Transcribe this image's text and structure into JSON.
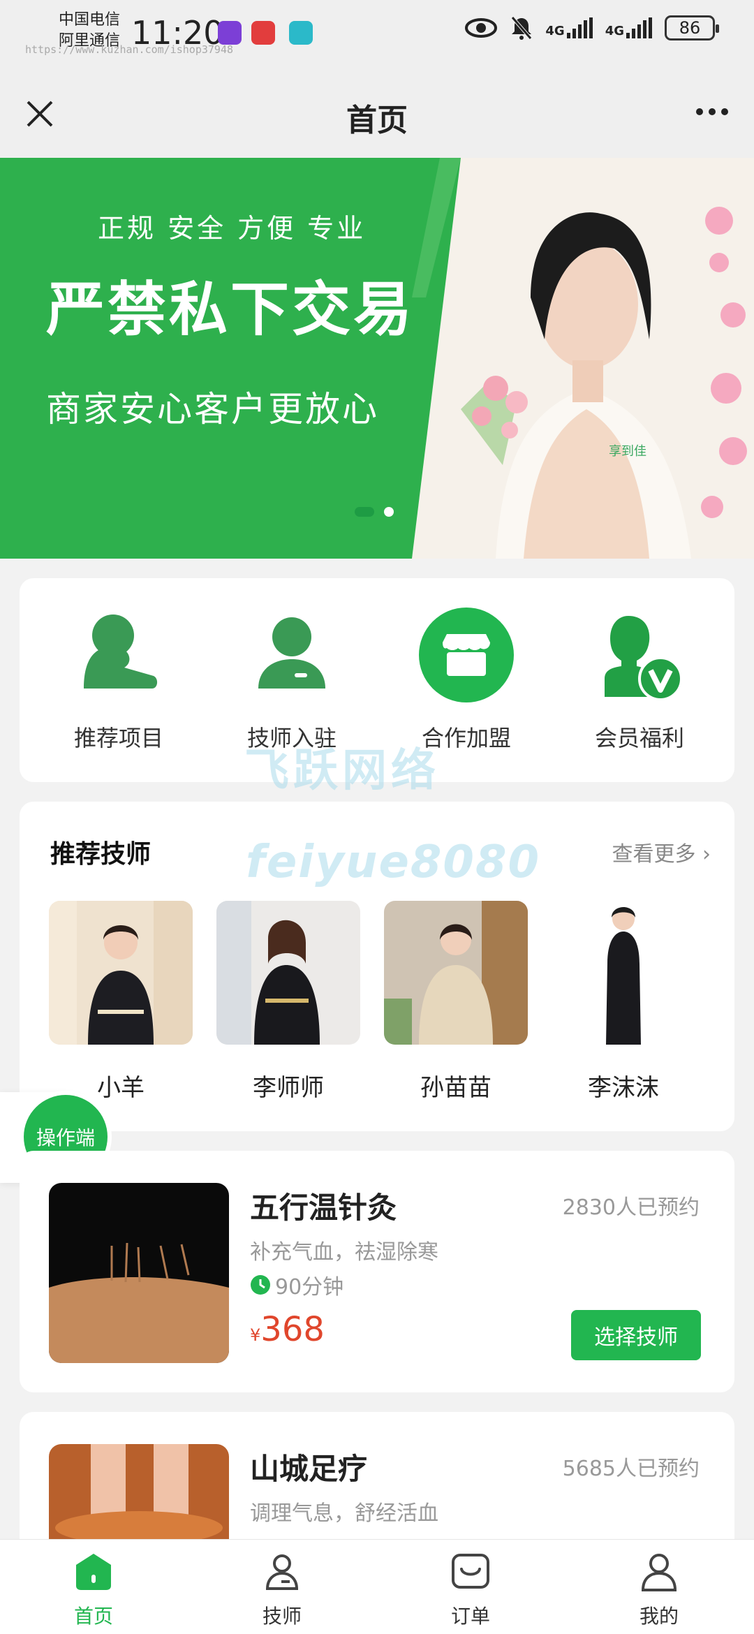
{
  "status_bar": {
    "carrier1": "中国电信",
    "carrier2": "阿里通信",
    "time": "11:20",
    "watermark_url": "https://www.kuzhan.com/ishop37948",
    "network1": "4G",
    "network2": "4G",
    "battery": "86"
  },
  "header": {
    "title": "首页"
  },
  "banner": {
    "slogan": "正规 安全 方便 专业",
    "headline": "严禁私下交易",
    "subline": "商家安心客户更放心",
    "photo_tag": "享到佳",
    "page_index": 1,
    "page_count": 2
  },
  "quick_menu": [
    {
      "label": "推荐项目",
      "icon": "person-icon"
    },
    {
      "label": "技师入驻",
      "icon": "technician-icon"
    },
    {
      "label": "合作加盟",
      "icon": "store-icon"
    },
    {
      "label": "会员福利",
      "icon": "vip-member-icon"
    }
  ],
  "watermarks": {
    "line1": "飞跃网络",
    "line2": "feiyue8080"
  },
  "therapists": {
    "title": "推荐技师",
    "see_more": "查看更多",
    "items": [
      {
        "name": "小羊"
      },
      {
        "name": "李师师"
      },
      {
        "name": "孙苗苗"
      },
      {
        "name": "李沫沫"
      }
    ]
  },
  "float_button": {
    "label": "操作端"
  },
  "services": [
    {
      "name": "五行温针灸",
      "booked": "2830人已预约",
      "desc": "补充气血，祛湿除寒",
      "duration": "90分钟",
      "currency": "¥",
      "price": "368",
      "button": "选择技师"
    },
    {
      "name": "山城足疗",
      "booked": "5685人已预约",
      "desc": "调理气息，舒经活血"
    }
  ],
  "tabbar": [
    {
      "label": "首页",
      "icon": "home-icon",
      "active": true
    },
    {
      "label": "技师",
      "icon": "technician-icon",
      "active": false
    },
    {
      "label": "订单",
      "icon": "order-bag-icon",
      "active": false
    },
    {
      "label": "我的",
      "icon": "user-icon",
      "active": false
    }
  ],
  "colors": {
    "brand_green": "#22b650",
    "banner_green": "#2eb04d",
    "price_red": "#e0462c",
    "muted_text": "#999999"
  }
}
